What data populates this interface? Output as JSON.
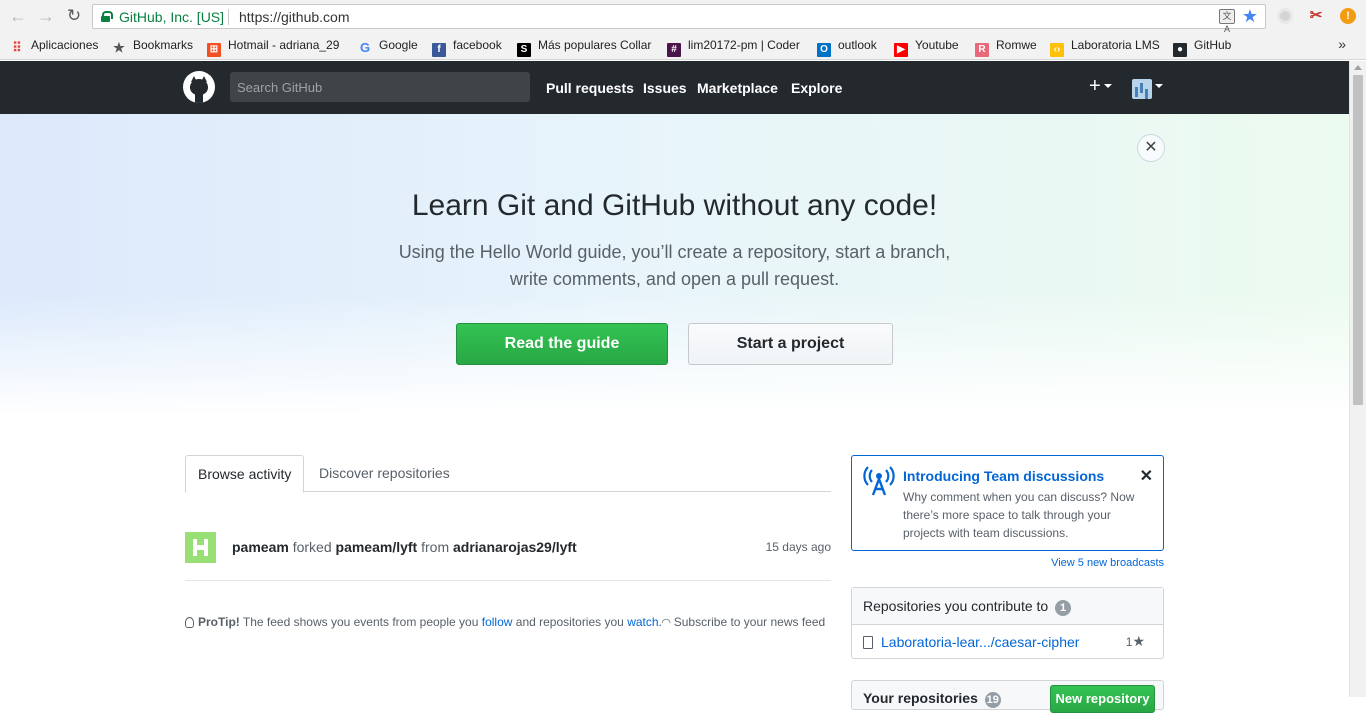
{
  "browser": {
    "site_identity": "GitHub, Inc. [US]",
    "url": "https://github.com",
    "bookmarks": [
      {
        "label": "Aplicaciones",
        "icon": "apps-grid-icon",
        "color": "#e8453c"
      },
      {
        "label": "Bookmarks",
        "icon": "star-icon",
        "color": "#555555"
      },
      {
        "label": "Hotmail - adriana_29",
        "icon": "windows-icon",
        "color": "#f25022"
      },
      {
        "label": "Google",
        "icon": "google-icon",
        "color": "#4285f4"
      },
      {
        "label": "facebook",
        "icon": "facebook-icon",
        "color": "#3b5998"
      },
      {
        "label": "Más populares Collar",
        "icon": "s-icon",
        "color": "#000000"
      },
      {
        "label": "lim20172-pm | Coder",
        "icon": "slack-icon",
        "color": "#4a154b"
      },
      {
        "label": "outlook",
        "icon": "outlook-icon",
        "color": "#0072c6"
      },
      {
        "label": "Youtube",
        "icon": "youtube-icon",
        "color": "#ff0000"
      },
      {
        "label": "Romwe",
        "icon": "romwe-icon",
        "color": "#e86a7a"
      },
      {
        "label": "Laboratoria LMS",
        "icon": "laboratoria-icon",
        "color": "#ffc107"
      },
      {
        "label": "GitHub",
        "icon": "github-icon",
        "color": "#24292e"
      }
    ],
    "more_bookmarks": "»"
  },
  "header": {
    "search_placeholder": "Search GitHub",
    "nav": [
      "Pull requests",
      "Issues",
      "Marketplace",
      "Explore"
    ],
    "plus": "+"
  },
  "hero": {
    "close": "✕",
    "title": "Learn Git and GitHub without any code!",
    "text_line1": "Using the Hello World guide, you’ll create a repository, start a branch,",
    "text_line2": "write comments, and open a pull request.",
    "primary_button": "Read the guide",
    "secondary_button": "Start a project"
  },
  "tabs": [
    "Browse activity",
    "Discover repositories"
  ],
  "feed": {
    "actor": "pameam",
    "action": "forked",
    "repo": "pameam/lyft",
    "from_word": "from",
    "source": "adrianarojas29/lyft",
    "time": "15 days ago"
  },
  "protip": {
    "label": "ProTip!",
    "text1": "The feed shows you events from people you",
    "follow": "follow",
    "text2": "and repositories you",
    "watch": "watch.",
    "text3": "Subscribe to your news feed"
  },
  "broadcast": {
    "title": "Introducing Team discussions",
    "body": "Why comment when you can discuss? Now there’s more space to talk through your projects with team discussions.",
    "close": "✕",
    "view_link": "View 5 new broadcasts"
  },
  "contribute": {
    "title": "Repositories you contribute to",
    "count": "1",
    "repo": "Laboratoria-lear.../caesar-cipher",
    "stars": "1"
  },
  "your_repos": {
    "title": "Your repositories",
    "count": "19",
    "new_button": "New repository"
  }
}
